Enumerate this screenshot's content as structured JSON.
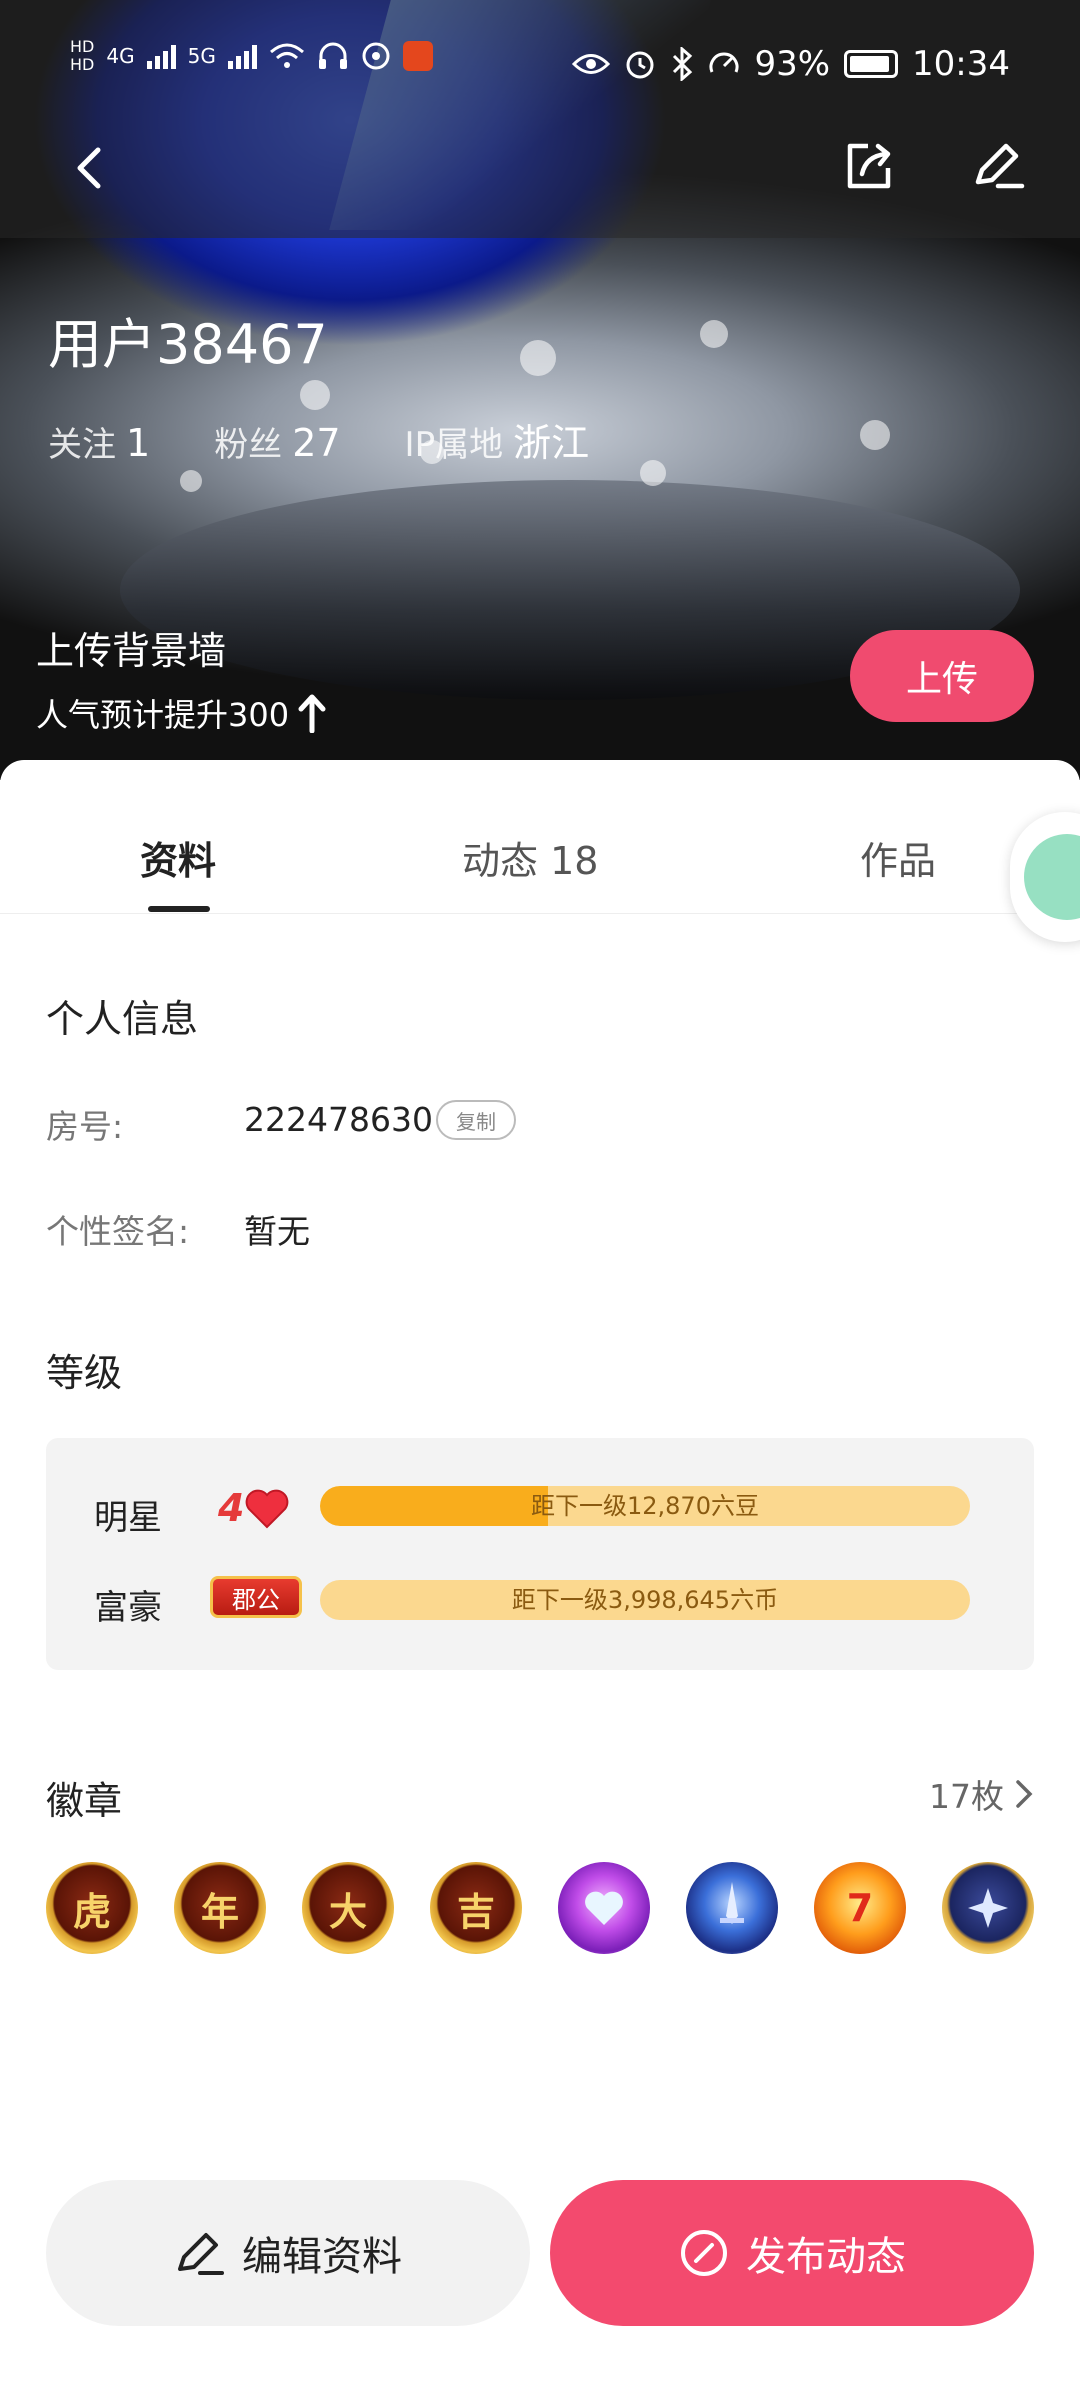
{
  "status_bar": {
    "network_hd1": "HD",
    "network_hd2": "HD",
    "net_4g": "4G",
    "net_5g": "5G",
    "battery": "93%",
    "time": "10:34"
  },
  "profile": {
    "username": "用户38467",
    "follow_label": "关注",
    "follow_count": "1",
    "fans_label": "粉丝",
    "fans_count": "27",
    "ip_label": "IP属地",
    "ip_value": "浙江"
  },
  "banner": {
    "title": "上传背景墙",
    "subtitle": "人气预计提升300",
    "upload_label": "上传"
  },
  "tabs": [
    {
      "label": "资料"
    },
    {
      "label": "动态 18"
    },
    {
      "label": "作品"
    }
  ],
  "personal_info": {
    "title": "个人信息",
    "room_label": "房号:",
    "room_value": "222478630",
    "copy_label": "复制",
    "signature_label": "个性签名:",
    "signature_value": "暂无"
  },
  "level": {
    "title": "等级",
    "star": {
      "name": "明星",
      "level": "4",
      "progress": 0.35,
      "text": "距下一级12,870六豆"
    },
    "rich": {
      "name": "富豪",
      "badge": "郡公",
      "progress": 0.0,
      "text": "距下一级3,998,645六币"
    }
  },
  "badges": {
    "title": "徽章",
    "count": "17枚",
    "items": [
      {
        "glyph": "虎",
        "kind": "gold"
      },
      {
        "glyph": "年",
        "kind": "gold"
      },
      {
        "glyph": "大",
        "kind": "gold"
      },
      {
        "glyph": "吉",
        "kind": "gold"
      },
      {
        "glyph": "",
        "kind": "purple-heart"
      },
      {
        "glyph": "",
        "kind": "blue-sword"
      },
      {
        "glyph": "7",
        "kind": "orange-seven"
      },
      {
        "glyph": "",
        "kind": "navy-star"
      }
    ]
  },
  "actions": {
    "edit_label": "编辑资料",
    "post_label": "发布动态"
  },
  "colors": {
    "accent": "#f34a6e",
    "progress_fill": "#f9ad1c",
    "progress_track": "#fbd88f"
  }
}
